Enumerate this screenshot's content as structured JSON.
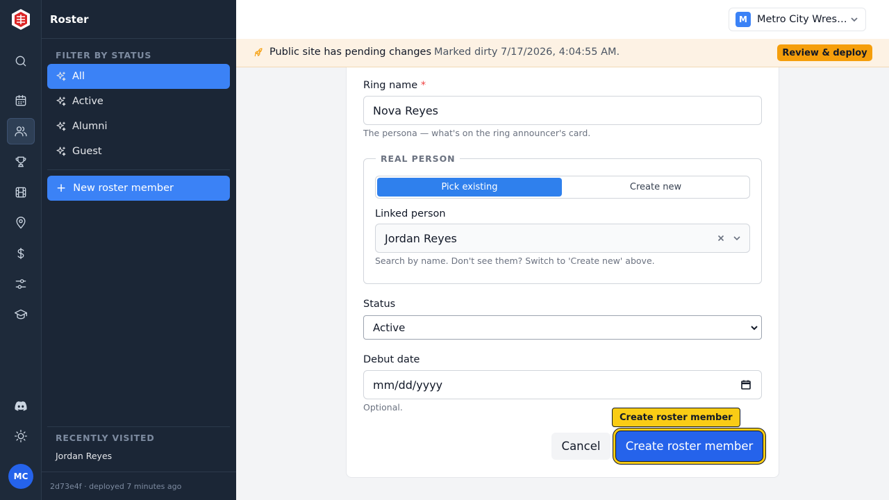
{
  "sidebar": {
    "title": "Roster",
    "filter_heading": "FILTER BY STATUS",
    "filters": [
      {
        "label": "All",
        "active": true
      },
      {
        "label": "Active",
        "active": false
      },
      {
        "label": "Alumni",
        "active": false
      },
      {
        "label": "Guest",
        "active": false
      }
    ],
    "new_button": "New roster member",
    "recent_heading": "RECENTLY VISITED",
    "recent_items": [
      "Jordan Reyes"
    ],
    "deploy_info": "2d73e4f · deployed 7 minutes ago"
  },
  "rail": {
    "icons": [
      "search-icon",
      "calendar-icon",
      "users-icon",
      "trophy-icon",
      "film-icon",
      "map-pin-icon",
      "dollar-icon",
      "sliders-icon",
      "graduation-cap-icon",
      "discord-icon",
      "sun-icon"
    ],
    "active": "users-icon",
    "avatar_initials": "MC"
  },
  "org_switcher": {
    "badge": "M",
    "name": "Metro City Wres…"
  },
  "banner": {
    "title": "Public site has pending changes",
    "subtitle": "Marked dirty 7/17/2026, 4:04:55 AM.",
    "button": "Review & deploy"
  },
  "form": {
    "ring_name": {
      "label": "Ring name",
      "required_mark": "*",
      "value": "Nova Reyes",
      "hint": "The persona — what's on the ring announcer's card."
    },
    "real_person": {
      "legend": "REAL PERSON",
      "tabs": [
        "Pick existing",
        "Create new"
      ],
      "selected_tab": "Pick existing",
      "linked_label": "Linked person",
      "linked_value": "Jordan Reyes",
      "linked_hint": "Search by name. Don't see them? Switch to 'Create new' above."
    },
    "status": {
      "label": "Status",
      "value": "Active"
    },
    "debut": {
      "label": "Debut date",
      "placeholder": "mm/dd/yyyy",
      "hint": "Optional."
    },
    "cancel": "Cancel",
    "submit": "Create roster member",
    "tooltip": "Create roster member"
  },
  "colors": {
    "accent": "#3b82f6",
    "primary_button": "#2563eb",
    "warning": "#f59e0b",
    "highlight": "#facc15",
    "sidebar_bg": "#1b2636"
  }
}
